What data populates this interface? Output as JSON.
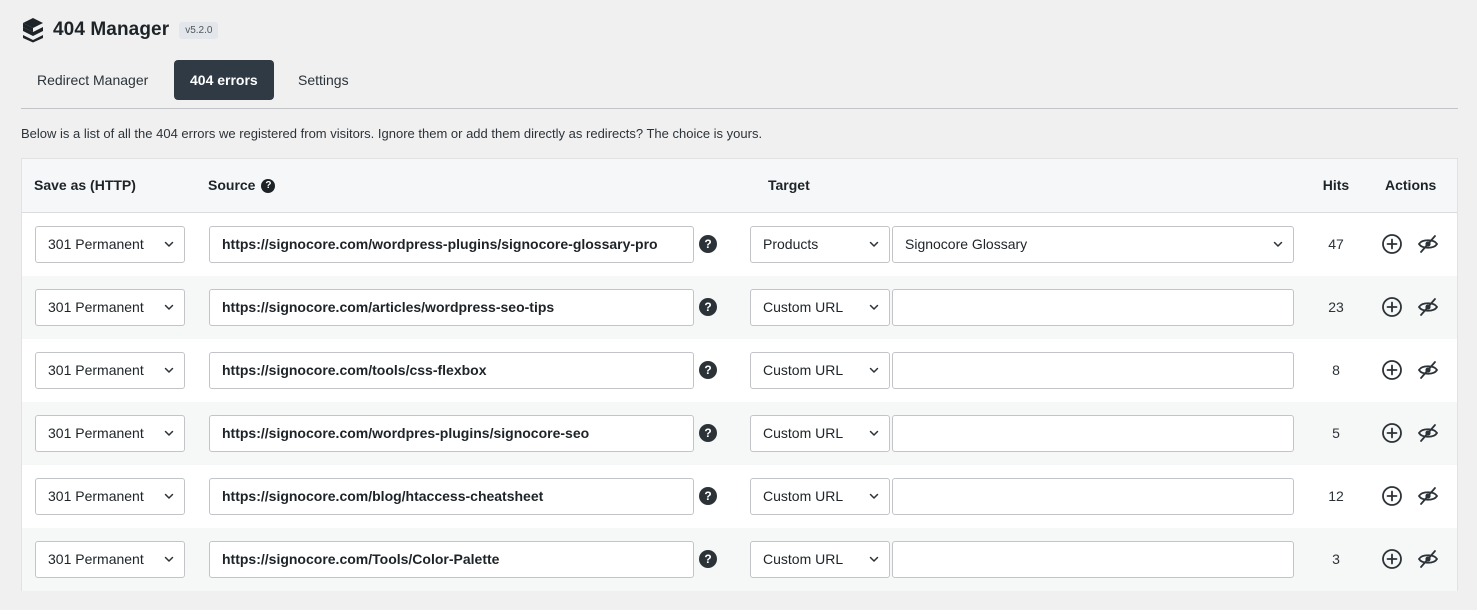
{
  "app": {
    "title": "404 Manager",
    "version": "v5.2.0"
  },
  "tabs": [
    {
      "label": "Redirect Manager",
      "active": false
    },
    {
      "label": "404 errors",
      "active": true
    },
    {
      "label": "Settings",
      "active": false
    }
  ],
  "description": "Below is a list of all the 404 errors we registered from visitors. Ignore them or add them directly as redirects? The choice is yours.",
  "table": {
    "headers": {
      "save_as": "Save as (HTTP)",
      "source": "Source",
      "target": "Target",
      "hits": "Hits",
      "actions": "Actions"
    },
    "help_glyph": "?",
    "rows": [
      {
        "save_as": "301 Permanent",
        "source": "https://signocore.com/wordpress-plugins/signocore-glossary-pro",
        "target_type": "Products",
        "target_value": "Signocore Glossary",
        "target_is_select": true,
        "hits": "47"
      },
      {
        "save_as": "301 Permanent",
        "source": "https://signocore.com/articles/wordpress-seo-tips",
        "target_type": "Custom URL",
        "target_value": "",
        "target_is_select": false,
        "hits": "23"
      },
      {
        "save_as": "301 Permanent",
        "source": "https://signocore.com/tools/css-flexbox",
        "target_type": "Custom URL",
        "target_value": "",
        "target_is_select": false,
        "hits": "8"
      },
      {
        "save_as": "301 Permanent",
        "source": "https://signocore.com/wordpres-plugins/signocore-seo",
        "target_type": "Custom URL",
        "target_value": "",
        "target_is_select": false,
        "hits": "5"
      },
      {
        "save_as": "301 Permanent",
        "source": "https://signocore.com/blog/htaccess-cheatsheet",
        "target_type": "Custom URL",
        "target_value": "",
        "target_is_select": false,
        "hits": "12"
      },
      {
        "save_as": "301 Permanent",
        "source": "https://signocore.com/Tools/Color-Palette",
        "target_type": "Custom URL",
        "target_value": "",
        "target_is_select": false,
        "hits": "3"
      }
    ]
  },
  "icons": {
    "logo": "logo-icon",
    "help": "question-circle-icon",
    "add": "plus-circle-icon",
    "ignore": "eye-slash-icon",
    "chevron": "chevron-down-icon"
  },
  "colors": {
    "active_tab_bg": "#2f3a44",
    "icon": "#2c3338"
  }
}
